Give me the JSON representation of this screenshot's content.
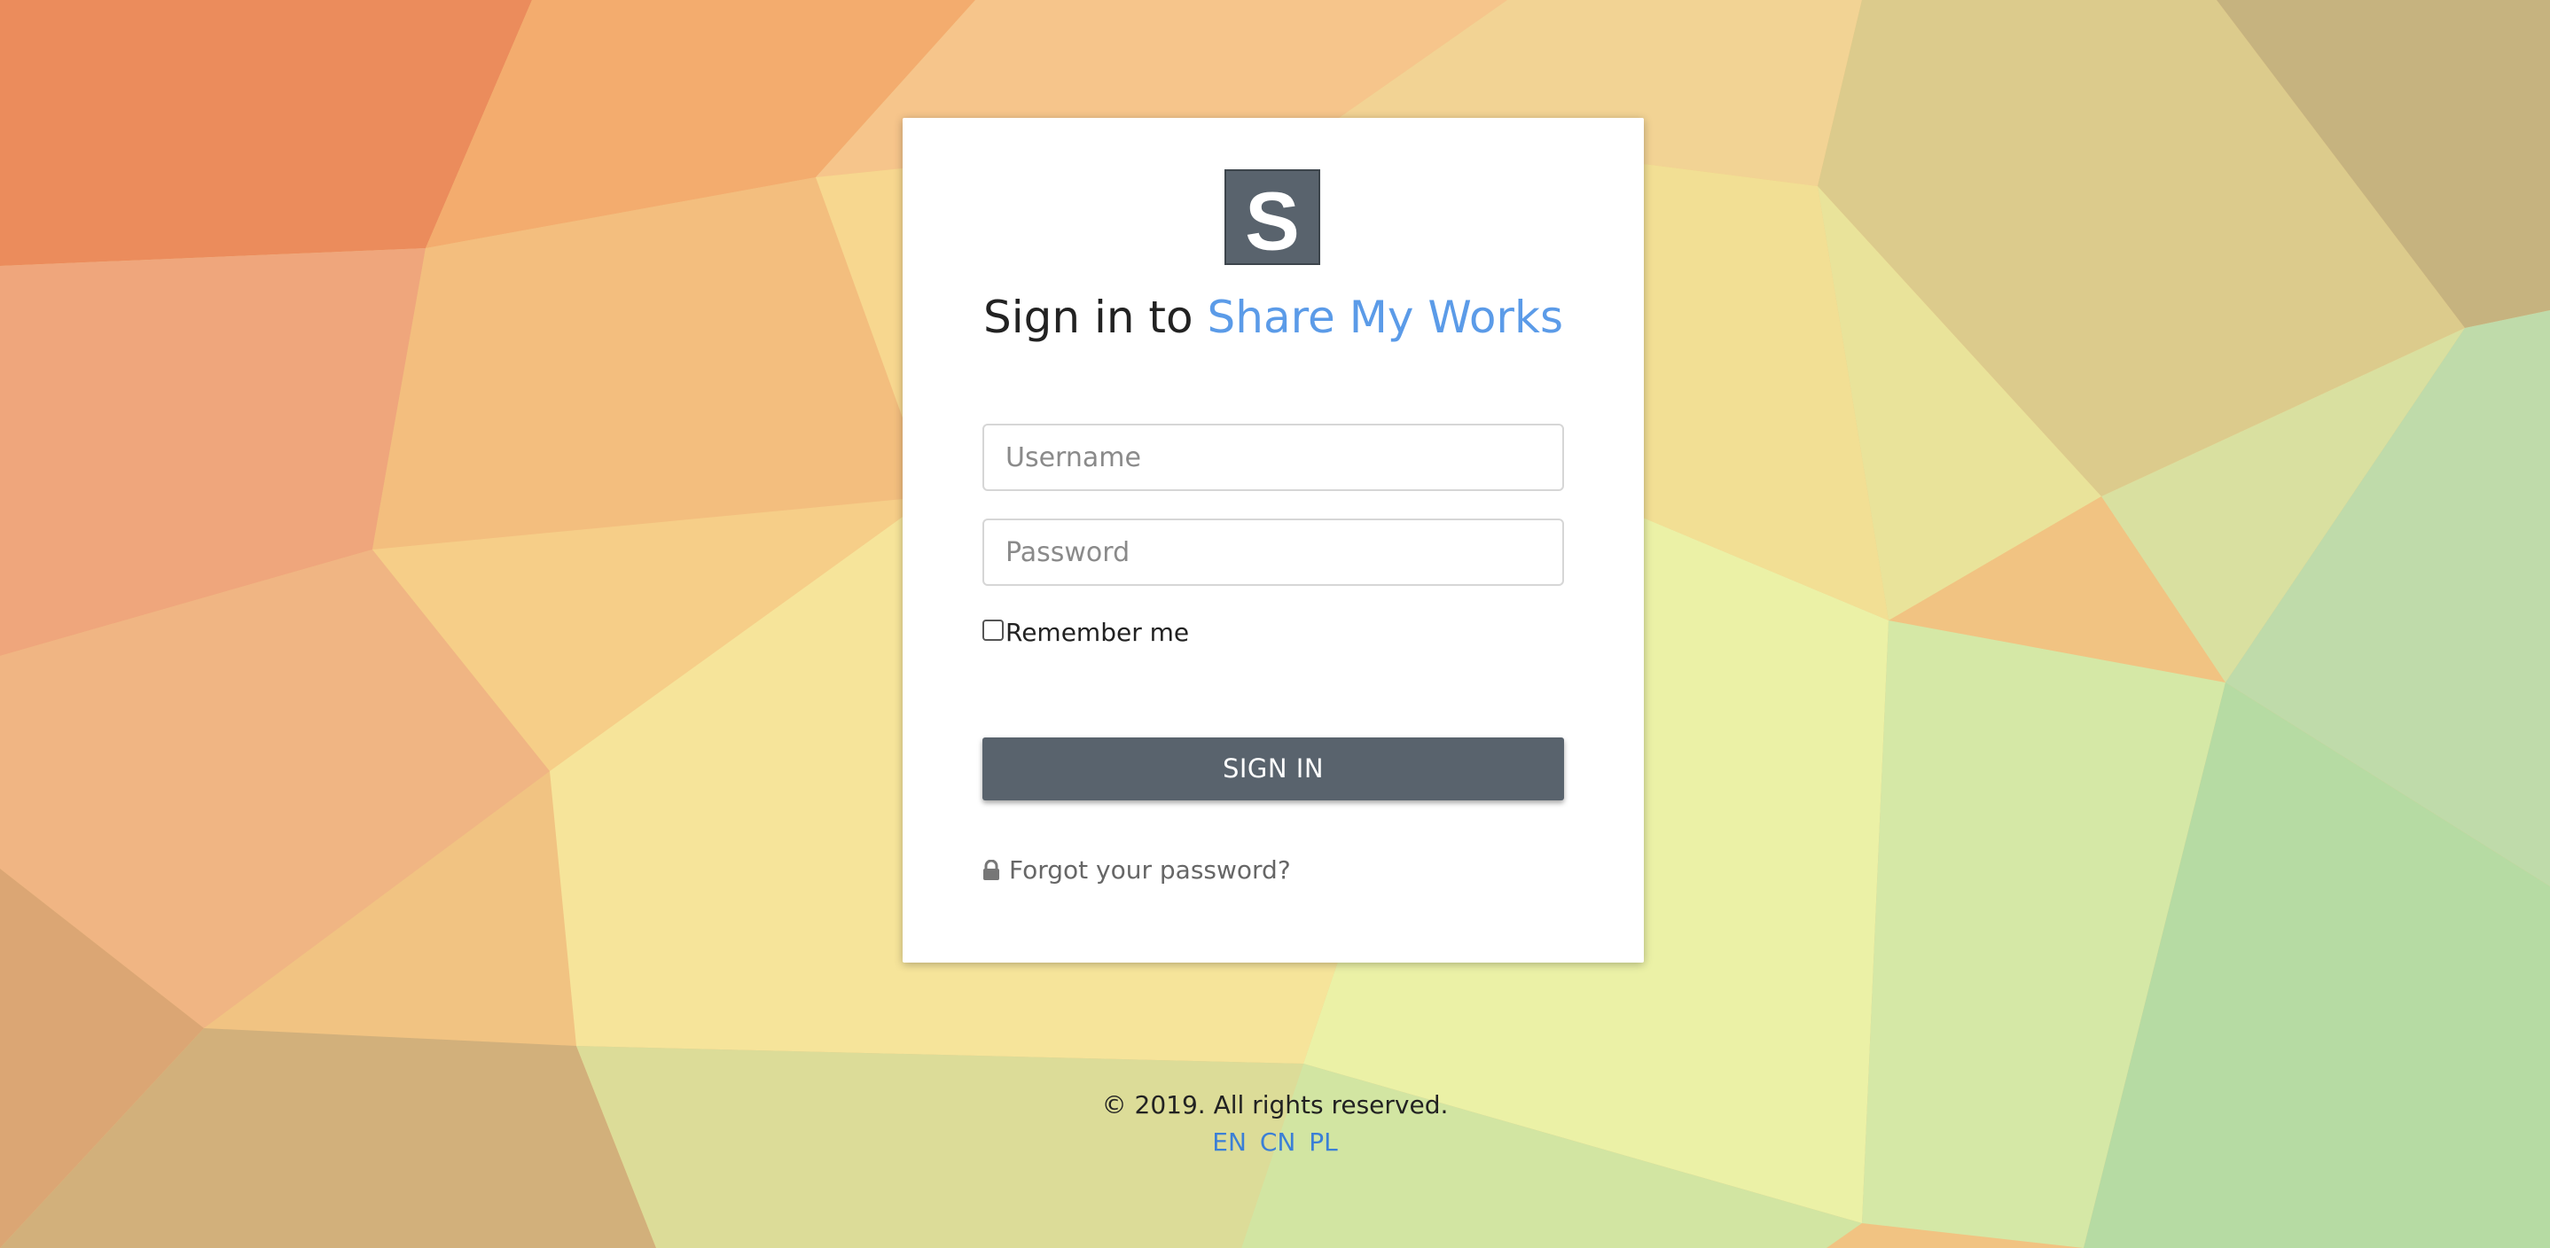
{
  "login": {
    "logo_letter": "S",
    "title_prefix": "Sign in to",
    "brand_name": "Share My Works",
    "username_placeholder": "Username",
    "password_placeholder": "Password",
    "remember_label": "Remember me",
    "remember_checked": false,
    "signin_label": "SIGN IN",
    "forgot_label": "Forgot your password?"
  },
  "footer": {
    "copyright": "© 2019. All rights reserved.",
    "languages": [
      "EN",
      "CN",
      "PL"
    ]
  },
  "icons": {
    "forgot": "lock-icon"
  },
  "colors": {
    "brand": "#5b9be8",
    "button": "#59636d",
    "link": "#3b7fd6"
  }
}
